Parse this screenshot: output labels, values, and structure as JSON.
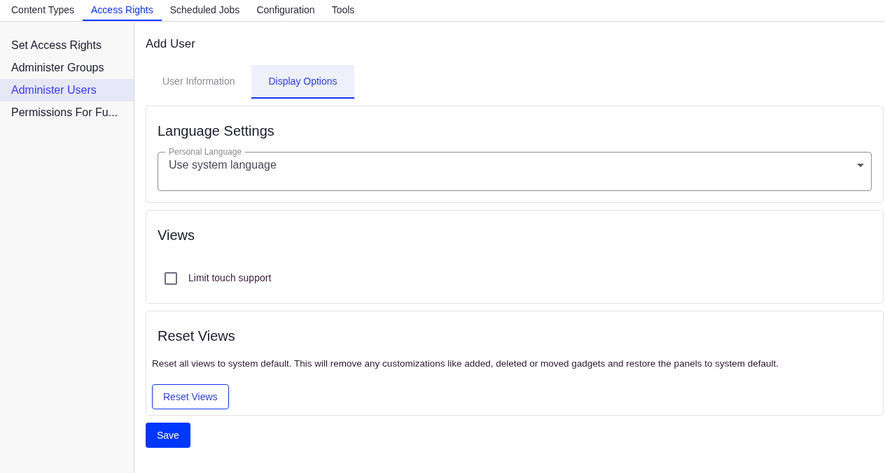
{
  "top_nav": [
    {
      "label": "Content Types",
      "selected": false
    },
    {
      "label": "Access Rights",
      "selected": true
    },
    {
      "label": "Scheduled Jobs",
      "selected": false
    },
    {
      "label": "Configuration",
      "selected": false
    },
    {
      "label": "Tools",
      "selected": false
    }
  ],
  "sidebar": {
    "items": [
      {
        "label": "Set Access Rights",
        "selected": false
      },
      {
        "label": "Administer Groups",
        "selected": false
      },
      {
        "label": "Administer Users",
        "selected": true
      },
      {
        "label": "Permissions For Fu...",
        "selected": false
      }
    ]
  },
  "page_title": "Add User",
  "tabs": [
    {
      "label": "User Information",
      "selected": false
    },
    {
      "label": "Display Options",
      "selected": true
    }
  ],
  "language_settings": {
    "title": "Language Settings",
    "field": {
      "label": "Personal Language",
      "value": "Use system language"
    }
  },
  "views": {
    "title": "Views",
    "checkbox": {
      "label": "Limit touch support",
      "checked": false
    }
  },
  "reset_views": {
    "title": "Reset Views",
    "description": "Reset all views to system default. This will remove any customizations like added, deleted or moved gadgets and restore the panels to system default.",
    "button": "Reset Views"
  },
  "save_button": "Save"
}
